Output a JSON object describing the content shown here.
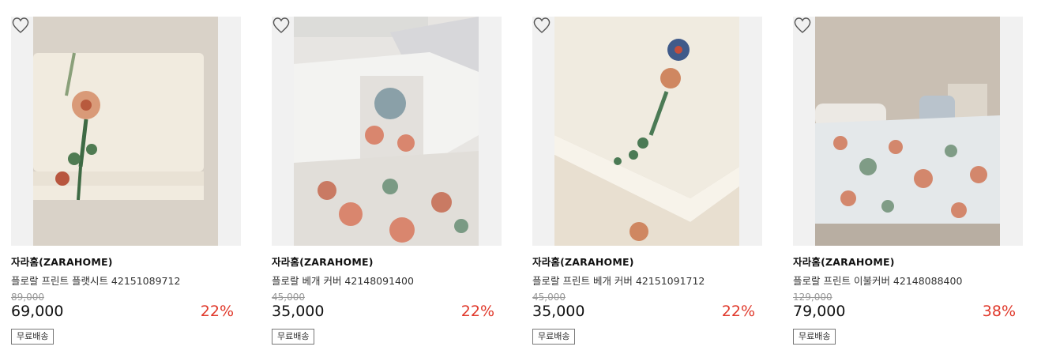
{
  "products": [
    {
      "brand": "자라홈(ZARAHOME)",
      "name": "플로랄 프린트 플랫시트 42151089712",
      "original_price": "89,000",
      "price": "69,000",
      "discount": "22%",
      "badge": "무료배송"
    },
    {
      "brand": "자라홈(ZARAHOME)",
      "name": "플로랄 베개 커버 42148091400",
      "original_price": "45,000",
      "price": "35,000",
      "discount": "22%",
      "badge": "무료배송"
    },
    {
      "brand": "자라홈(ZARAHOME)",
      "name": "플로랄 프린트 베개 커버 42151091712",
      "original_price": "45,000",
      "price": "35,000",
      "discount": "22%",
      "badge": "무료배송"
    },
    {
      "brand": "자라홈(ZARAHOME)",
      "name": "플로랄 프린트 이불커버 42148088400",
      "original_price": "129,000",
      "price": "79,000",
      "discount": "38%",
      "badge": "무료배송"
    }
  ],
  "colors": {
    "discount": "#e0392b",
    "thumb_bg": "#f1f1f1"
  },
  "icons": {
    "wishlist": "heart-outline-icon"
  }
}
